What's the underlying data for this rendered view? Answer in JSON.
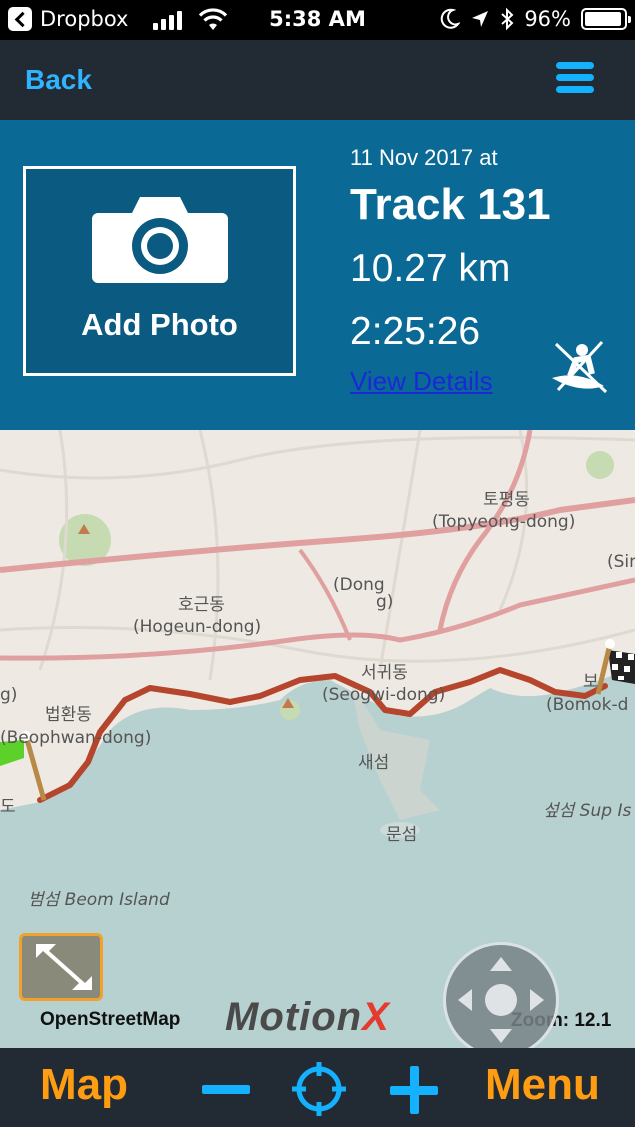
{
  "status_bar": {
    "back_app": "Dropbox",
    "time": "5:38 AM",
    "battery": "96%",
    "battery_level": 0.96,
    "icons": [
      "back-chevron-icon",
      "signal-icon",
      "wifi-icon",
      "moon-icon",
      "location-arrow-icon",
      "bluetooth-icon",
      "battery-icon"
    ]
  },
  "nav": {
    "back_label": "Back",
    "menu_icon": "hamburger-menu-icon"
  },
  "track": {
    "photo_label": "Add Photo",
    "date": "11 Nov 2017 at",
    "name": "Track 131",
    "distance": "10.27 km",
    "duration": "2:25:26",
    "details_link": "View Details",
    "activity_icon": "kayak-icon"
  },
  "map": {
    "places": [
      "토평동",
      "(Topyeong-dong)",
      "(Sin",
      "(Dong",
      "g)",
      "호근동",
      "(Hogeun-dong)",
      "서귀동",
      "(Seogwi-dong)",
      "보",
      "(Bomok-d",
      "g)",
      "법환동",
      "(Beophwan-dong)",
      "새섬",
      "섶섬 Sup Is",
      "문섬",
      "범섬 Beom Island",
      "도"
    ],
    "attribution": "OpenStreetMap",
    "brand_main": "Motion",
    "brand_x": "X",
    "zoom_label": "Zoom: 12.1",
    "colors": {
      "track": "#b5452c",
      "sea": "#b7d1d0",
      "land": "#eeeae3"
    }
  },
  "toolbar": {
    "map_label": "Map",
    "menu_label": "Menu",
    "colors": {
      "accent": "#ff9d12",
      "blue": "#14b1ff"
    }
  }
}
